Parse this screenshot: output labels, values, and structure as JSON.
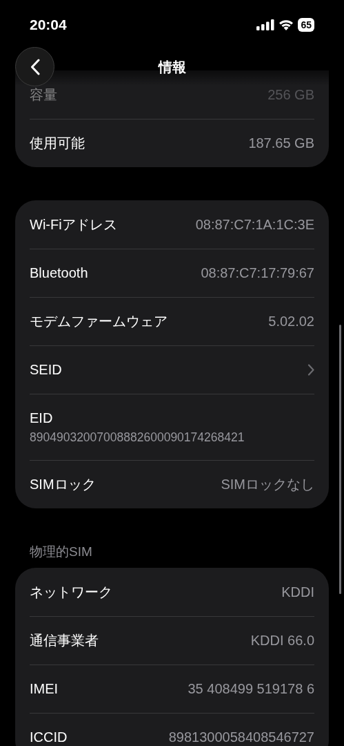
{
  "status_bar": {
    "time": "20:04",
    "battery": "65"
  },
  "header": {
    "title": "情報"
  },
  "sections": [
    {
      "rows": [
        {
          "kind": "value",
          "label": "容量",
          "value": "256 GB",
          "dimmed": true
        },
        {
          "kind": "value",
          "label": "使用可能",
          "value": "187.65 GB",
          "dimmed": false
        }
      ]
    },
    {
      "rows": [
        {
          "kind": "value",
          "label": "Wi-Fiアドレス",
          "value": "08:87:C7:1A:1C:3E",
          "dimmed": false
        },
        {
          "kind": "value",
          "label": "Bluetooth",
          "value": "08:87:C7:17:79:67",
          "dimmed": false
        },
        {
          "kind": "value",
          "label": "モデムファームウェア",
          "value": "5.02.02",
          "dimmed": false
        },
        {
          "kind": "chevron",
          "label": "SEID",
          "dimmed": false
        },
        {
          "kind": "stacked",
          "label": "EID",
          "value": "89049032007008882600090174268421",
          "dimmed": false
        },
        {
          "kind": "value",
          "label": "SIMロック",
          "value": "SIMロックなし",
          "dimmed": false
        }
      ]
    },
    {
      "header": "物理的SIM",
      "rows": [
        {
          "kind": "value",
          "label": "ネットワーク",
          "value": "KDDI",
          "dimmed": false
        },
        {
          "kind": "value",
          "label": "通信事業者",
          "value": "KDDI 66.0",
          "dimmed": false
        },
        {
          "kind": "value",
          "label": "IMEI",
          "value": "35 408499 519178 6",
          "dimmed": false
        },
        {
          "kind": "value",
          "label": "ICCID",
          "value": "8981300058408546727",
          "dimmed": false
        }
      ]
    }
  ]
}
